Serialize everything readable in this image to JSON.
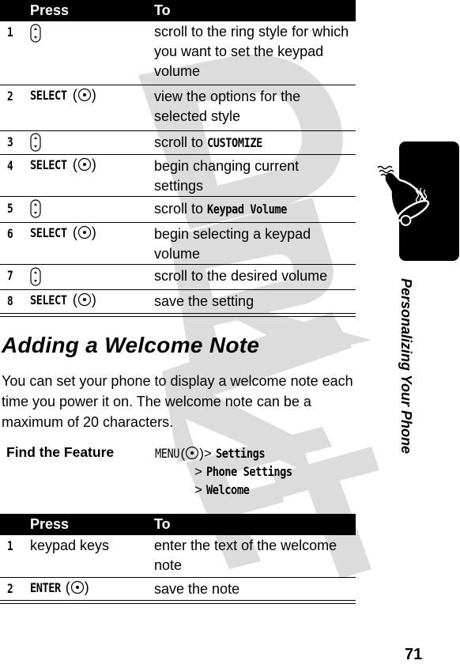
{
  "table1": {
    "header": {
      "press": "Press",
      "to": "To"
    },
    "rows": [
      {
        "num": "1",
        "press_type": "nav-key",
        "to": "scroll to the ring style for which you want to set the keypad volume"
      },
      {
        "num": "2",
        "press_key": "SELECT",
        "press_type": "select",
        "to": "view the options for the selected style"
      },
      {
        "num": "3",
        "press_type": "nav-key",
        "to_prefix": "scroll to ",
        "to_key": "CUSTOMIZE"
      },
      {
        "num": "4",
        "press_key": "SELECT",
        "press_type": "select",
        "to": "begin changing current settings"
      },
      {
        "num": "5",
        "press_type": "nav-key",
        "to_prefix": "scroll to ",
        "to_key": "Keypad Volume"
      },
      {
        "num": "6",
        "press_key": "SELECT",
        "press_type": "select",
        "to": "begin selecting a keypad volume"
      },
      {
        "num": "7",
        "press_type": "nav-key",
        "to": "scroll to the desired volume"
      },
      {
        "num": "8",
        "press_key": "SELECT",
        "press_type": "select",
        "to": "save the setting"
      }
    ]
  },
  "section": {
    "heading": "Adding a Welcome Note",
    "paragraph": "You can set your phone to display a welcome note each time you power it on. The welcome note can be a maximum of 20 characters."
  },
  "find_feature": {
    "label": "Find the Feature",
    "menu_key": "MENU",
    "path": [
      "Settings",
      "Phone Settings",
      "Welcome"
    ]
  },
  "table2": {
    "header": {
      "press": "Press",
      "to": "To"
    },
    "rows": [
      {
        "num": "1",
        "press": "keypad keys",
        "to": "enter the text of the welcome note"
      },
      {
        "num": "2",
        "press_key": "ENTER",
        "press_type": "select",
        "to": "save the note"
      }
    ]
  },
  "sidebar": {
    "tab_icon": "ringing-bell-icon",
    "chapter_title": "Personalizing Your Phone"
  },
  "watermark": "DRAFT",
  "page_number": "71",
  "colors": {
    "ink": "#000000",
    "watermark": "#d9d9d9",
    "paper": "#ffffff"
  }
}
